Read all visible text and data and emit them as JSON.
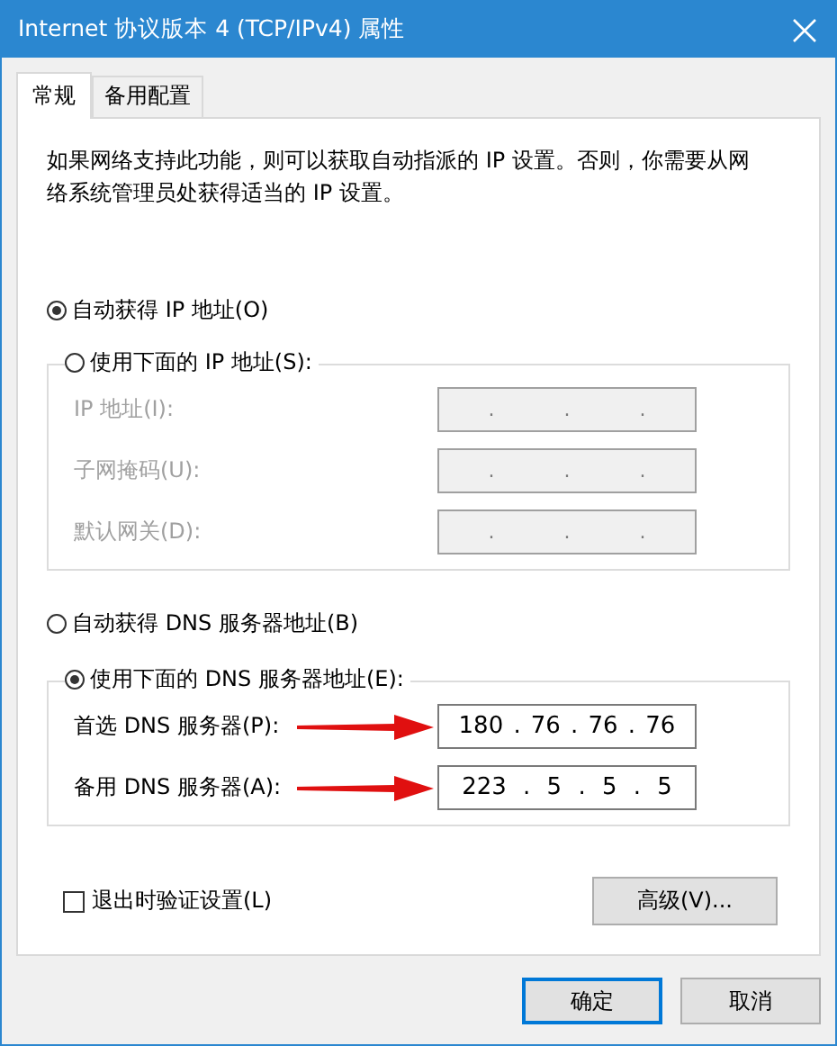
{
  "window": {
    "title": "Internet 协议版本 4 (TCP/IPv4) 属性"
  },
  "tabs": [
    {
      "label": "常规",
      "selected": true
    },
    {
      "label": "备用配置",
      "selected": false
    }
  ],
  "description": "如果网络支持此功能，则可以获取自动指派的 IP 设置。否则，你需要从网络系统管理员处获得适当的 IP 设置。",
  "ip_mode": [
    {
      "label": "自动获得 IP 地址(O)",
      "selected": true
    },
    {
      "label": "使用下面的 IP 地址(S):",
      "selected": false
    }
  ],
  "ip_fields": [
    {
      "label": "IP 地址(I):",
      "disabled": true,
      "parts": [
        ".",
        ".",
        "."
      ]
    },
    {
      "label": "子网掩码(U):",
      "disabled": true,
      "parts": [
        ".",
        ".",
        "."
      ]
    },
    {
      "label": "默认网关(D):",
      "disabled": true,
      "parts": [
        ".",
        ".",
        "."
      ]
    }
  ],
  "dns_mode": [
    {
      "label": "自动获得 DNS 服务器地址(B)",
      "selected": false
    },
    {
      "label": "使用下面的 DNS 服务器地址(E):",
      "selected": true
    }
  ],
  "dns_fields": [
    {
      "label": "首选 DNS 服务器(P):",
      "disabled": false,
      "parts": [
        "180",
        ".",
        "76",
        ".",
        "76",
        ".",
        "76"
      ]
    },
    {
      "label": "备用 DNS 服务器(A):",
      "disabled": false,
      "parts": [
        "223",
        ".",
        "5",
        ".",
        "5",
        ".",
        "5"
      ]
    }
  ],
  "validate_checkbox": {
    "label": "退出时验证设置(L)",
    "checked": false
  },
  "advanced_button": "高级(V)...",
  "buttons": [
    {
      "label": "确定",
      "default": true
    },
    {
      "label": "取消",
      "default": false
    }
  ]
}
